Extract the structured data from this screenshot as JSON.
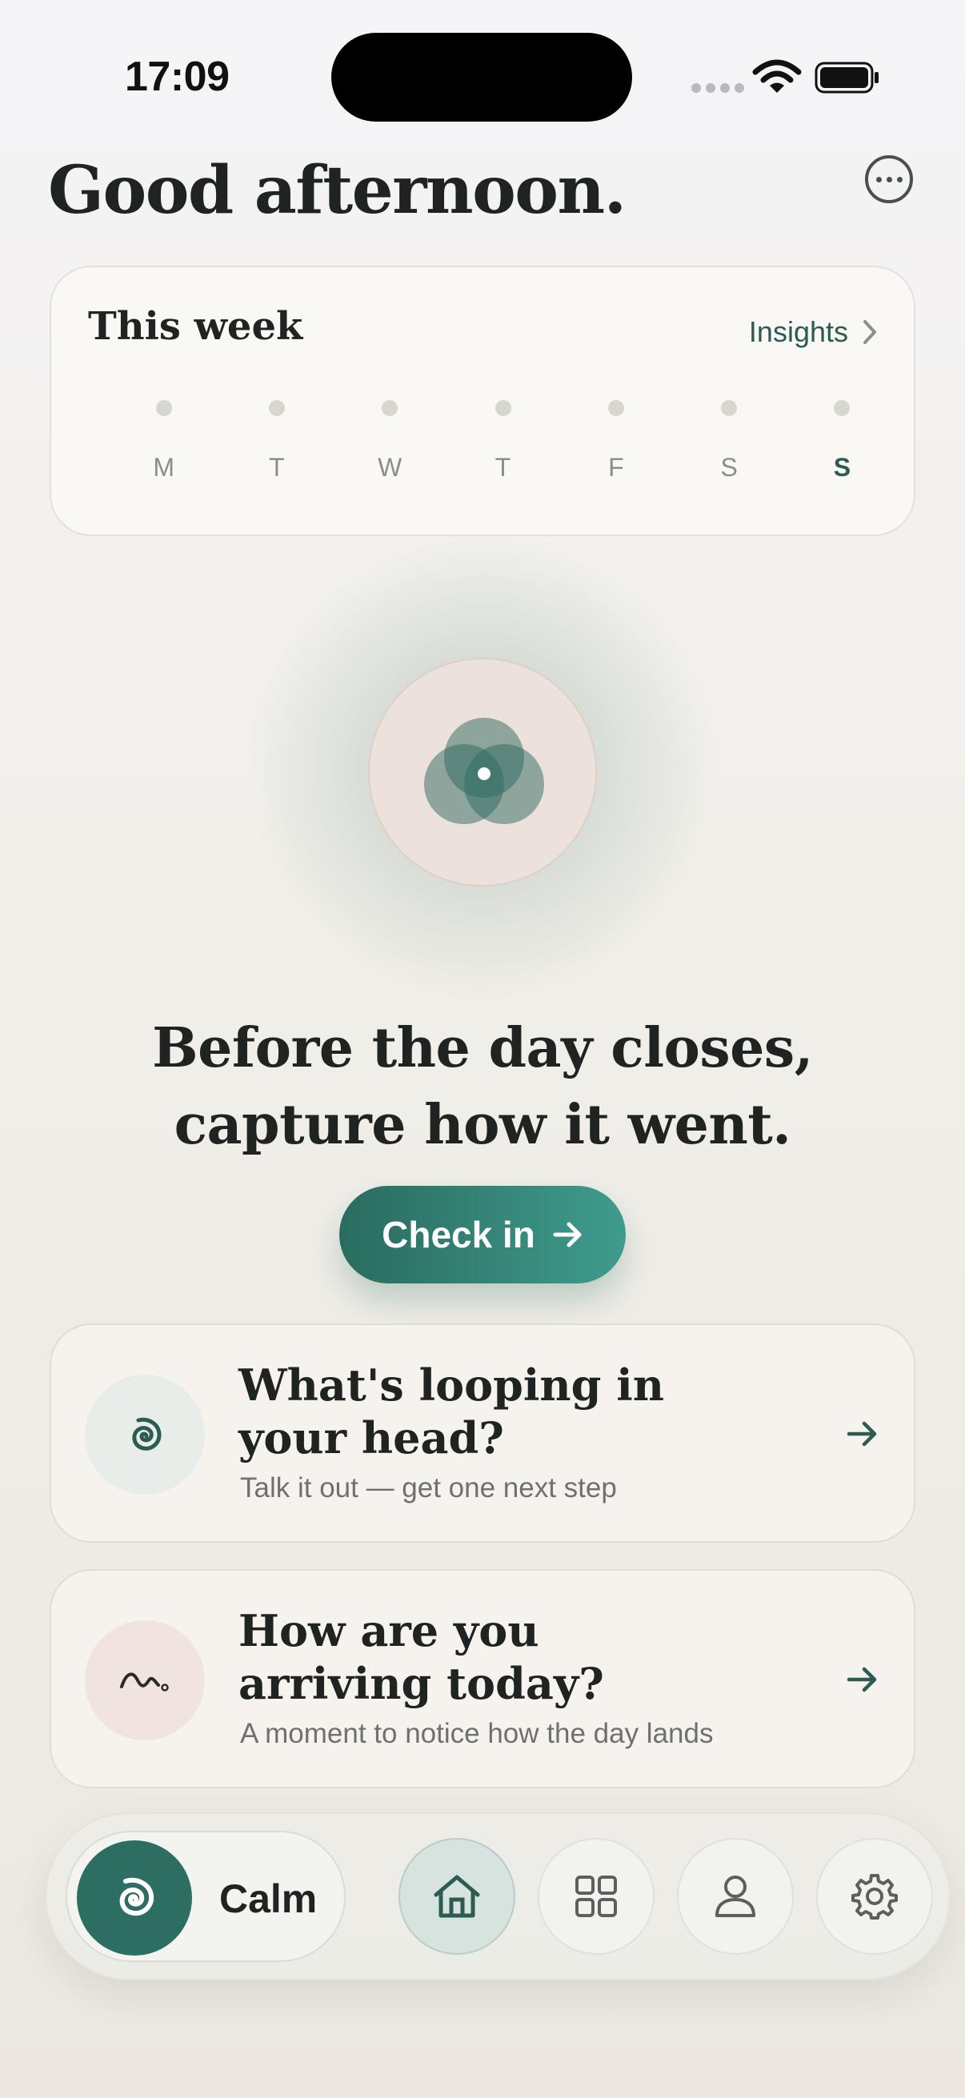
{
  "status_bar": {
    "time": "17:09"
  },
  "header": {
    "greeting": "Good afternoon.",
    "more_icon": "more-horizontal-icon"
  },
  "week": {
    "title": "This week",
    "insights_label": "Insights",
    "days": [
      {
        "label": "M",
        "today": false
      },
      {
        "label": "T",
        "today": false
      },
      {
        "label": "W",
        "today": false
      },
      {
        "label": "T",
        "today": false
      },
      {
        "label": "F",
        "today": false
      },
      {
        "label": "S",
        "today": false
      },
      {
        "label": "S",
        "today": true
      }
    ]
  },
  "prompt": {
    "line1": "Before the day closes,",
    "line2": "capture how it went.",
    "checkin_label": "Check in"
  },
  "options": [
    {
      "title_line1": "What's looping in",
      "title_line2": "your head?",
      "subtitle": "Talk it out — get one next step",
      "icon": "spiral-icon"
    },
    {
      "title_line1": "How are you",
      "title_line2": "arriving today?",
      "subtitle": "A moment to notice how the day lands",
      "icon": "squiggle-icon"
    }
  ],
  "tabbar": {
    "calm_label": "Calm",
    "tabs": [
      {
        "icon": "home-icon",
        "active": true
      },
      {
        "icon": "grid-icon",
        "active": false
      },
      {
        "icon": "person-icon",
        "active": false
      },
      {
        "icon": "gear-icon",
        "active": false
      }
    ]
  },
  "colors": {
    "accent": "#2d6e62",
    "accent_light": "#3f9c8d",
    "text": "#1f2321",
    "muted": "#6e716f"
  }
}
